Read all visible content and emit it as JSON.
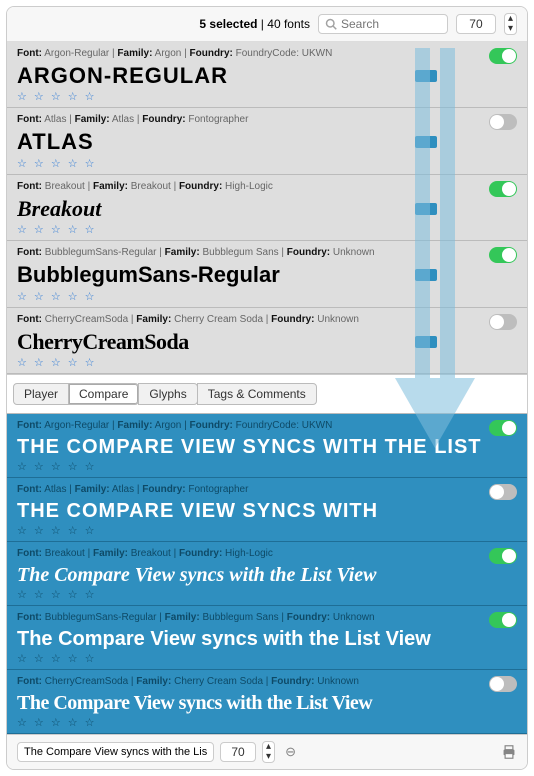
{
  "toolbar": {
    "selected_label": "5 selected",
    "divider": " | ",
    "total_label": "40 fonts",
    "search_placeholder": "Search",
    "size_value": "70"
  },
  "fonts": [
    {
      "name_label": "Font:",
      "name": "Argon-Regular",
      "family_label": "Family:",
      "family": "Argon",
      "foundry_label": "Foundry:",
      "foundry": "FoundryCode: UKWN",
      "sample": "ARGON-REGULAR",
      "toggle": "on"
    },
    {
      "name_label": "Font:",
      "name": "Atlas",
      "family_label": "Family:",
      "family": "Atlas",
      "foundry_label": "Foundry:",
      "foundry": "Fontographer",
      "sample": "ATLAS",
      "toggle": "off"
    },
    {
      "name_label": "Font:",
      "name": "Breakout",
      "family_label": "Family:",
      "family": "Breakout",
      "foundry_label": "Foundry:",
      "foundry": "High-Logic",
      "sample": "Breakout",
      "toggle": "on"
    },
    {
      "name_label": "Font:",
      "name": "BubblegumSans-Regular",
      "family_label": "Family:",
      "family": "Bubblegum Sans",
      "foundry_label": "Foundry:",
      "foundry": "Unknown",
      "sample": "BubblegumSans-Regular",
      "toggle": "on"
    },
    {
      "name_label": "Font:",
      "name": "CherryCreamSoda",
      "family_label": "Family:",
      "family": "Cherry Cream Soda",
      "foundry_label": "Foundry:",
      "foundry": "Unknown",
      "sample": "CherryCreamSoda",
      "toggle": "off"
    }
  ],
  "tabs": {
    "player": "Player",
    "compare": "Compare",
    "glyphs": "Glyphs",
    "tags": "Tags & Comments"
  },
  "compare_text": "The Compare View syncs with the List View",
  "compare_text_upper": "THE COMPARE VIEW SYNCS WITH THE LIST",
  "compare_text_upper2": "THE COMPARE VIEW SYNCS WITH",
  "compare": [
    {
      "name_label": "Font:",
      "name": "Argon-Regular",
      "family_label": "Family:",
      "family": "Argon",
      "foundry_label": "Foundry:",
      "foundry": "FoundryCode: UKWN",
      "toggle": "on",
      "style": "argon",
      "sample_key": "compare_text_upper"
    },
    {
      "name_label": "Font:",
      "name": "Atlas",
      "family_label": "Family:",
      "family": "Atlas",
      "foundry_label": "Foundry:",
      "foundry": "Fontographer",
      "toggle": "off",
      "style": "atlas",
      "sample_key": "compare_text_upper2"
    },
    {
      "name_label": "Font:",
      "name": "Breakout",
      "family_label": "Family:",
      "family": "Breakout",
      "foundry_label": "Foundry:",
      "foundry": "High-Logic",
      "toggle": "on",
      "style": "breakout",
      "sample_key": "compare_text"
    },
    {
      "name_label": "Font:",
      "name": "BubblegumSans-Regular",
      "family_label": "Family:",
      "family": "Bubblegum Sans",
      "foundry_label": "Foundry:",
      "foundry": "Unknown",
      "toggle": "on",
      "style": "bubblegum",
      "sample_key": "compare_text"
    },
    {
      "name_label": "Font:",
      "name": "CherryCreamSoda",
      "family_label": "Family:",
      "family": "Cherry Cream Soda",
      "foundry_label": "Foundry:",
      "foundry": "Unknown",
      "toggle": "off",
      "style": "cherry",
      "sample_key": "compare_text"
    }
  ],
  "bottom": {
    "text_value": "The Compare View syncs with the List View",
    "size_value": "70",
    "reset_icon": "⊖"
  },
  "stars_display": "☆ ☆ ☆ ☆ ☆"
}
